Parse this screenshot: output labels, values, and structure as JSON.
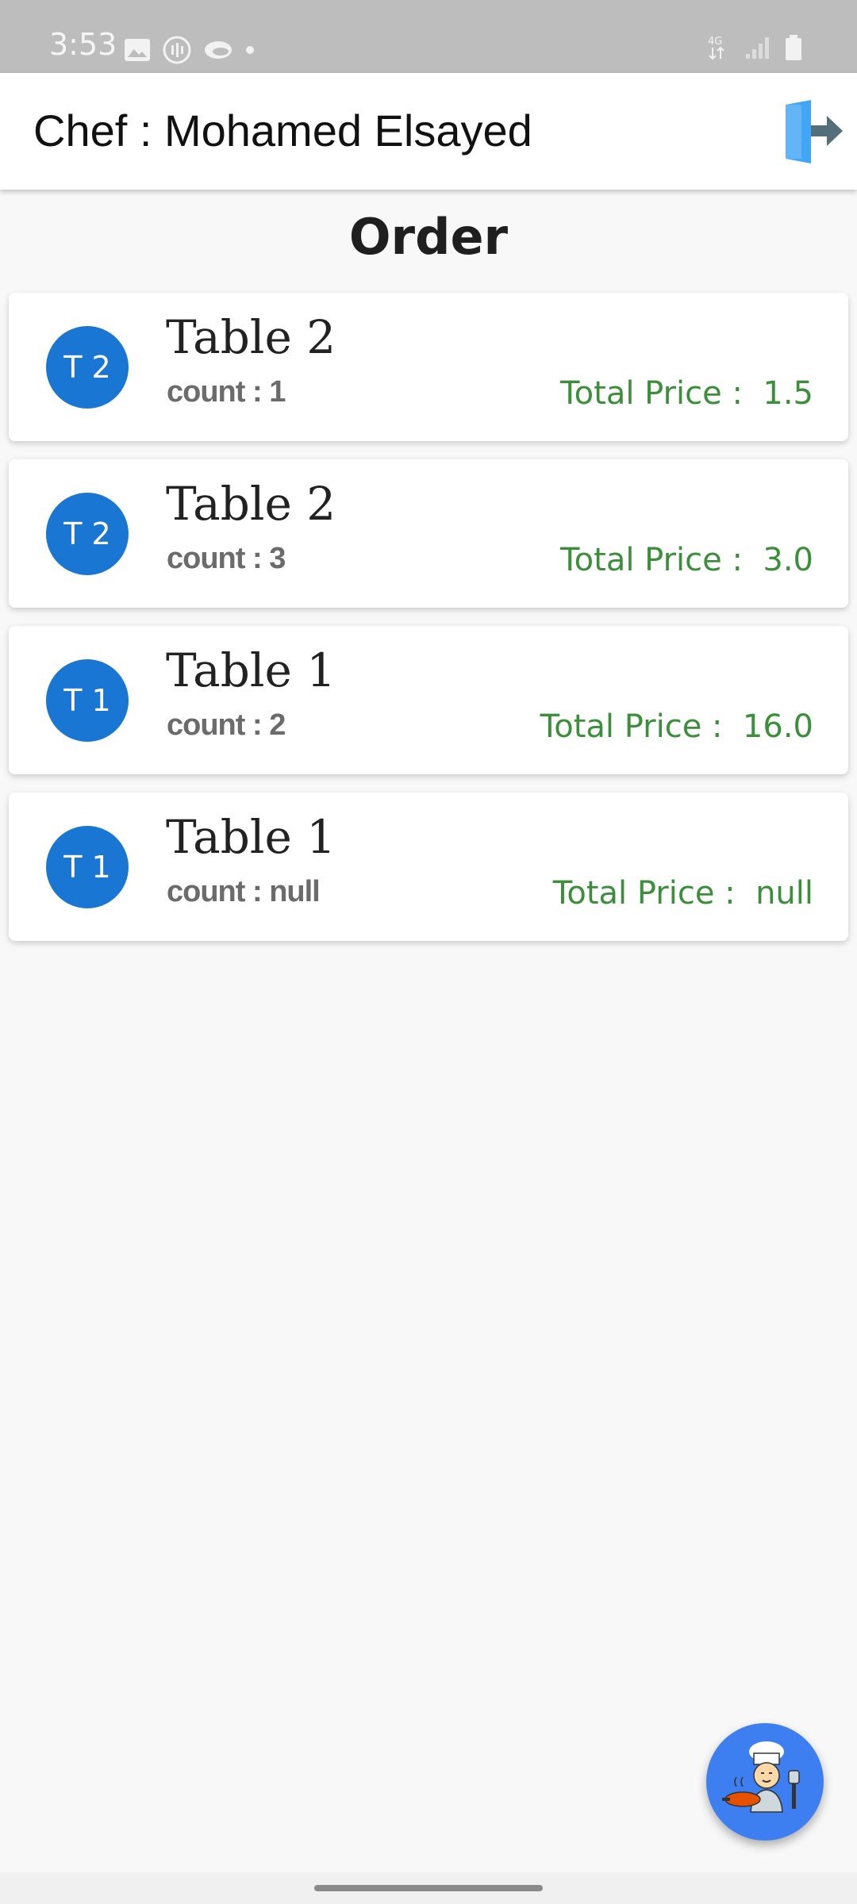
{
  "status_bar": {
    "time": "3:53",
    "network": "4G"
  },
  "app_bar": {
    "title": "Chef : Mohamed Elsayed"
  },
  "section_title": "Order",
  "orders": [
    {
      "avatar": "T 2",
      "name": "Table 2",
      "count": "count : 1",
      "price": "Total Price :  1.5"
    },
    {
      "avatar": "T 2",
      "name": "Table 2",
      "count": "count : 3",
      "price": "Total Price :  3.0"
    },
    {
      "avatar": "T 1",
      "name": "Table 1",
      "count": "count : 2",
      "price": "Total Price :  16.0"
    },
    {
      "avatar": "T 1",
      "name": "Table 1",
      "count": "count : null",
      "price": "Total Price :  null"
    }
  ],
  "colors": {
    "avatar": "#1976d2",
    "price": "#3c8f3a",
    "fab": "#3d7ff0"
  },
  "icons": {
    "logout": "logout-door-icon",
    "fab": "chef-cooking-icon"
  }
}
